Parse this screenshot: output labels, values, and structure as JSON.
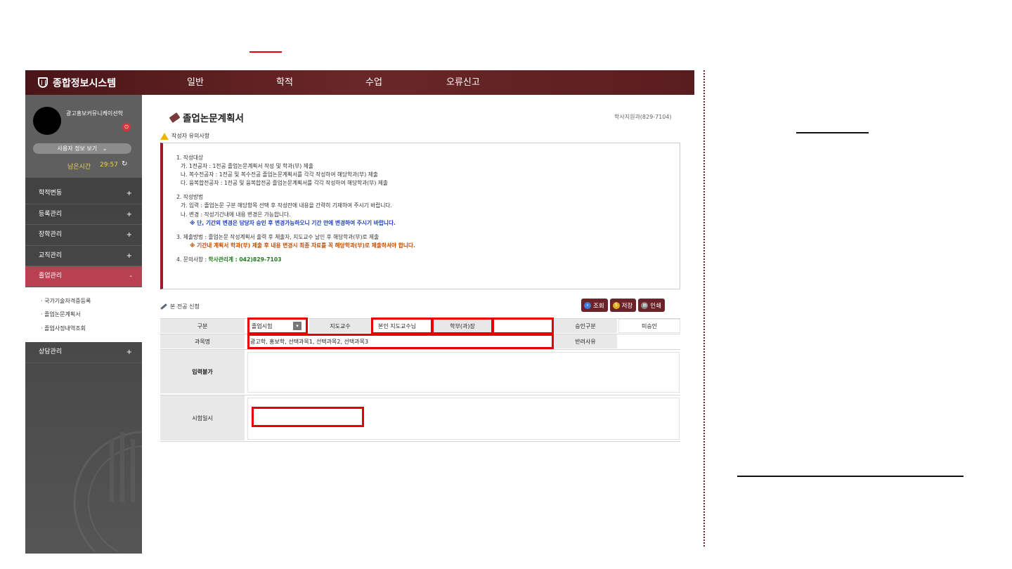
{
  "header": {
    "system_title": "종합정보시스템",
    "nav": [
      "일반",
      "학적",
      "수업",
      "오류신고"
    ]
  },
  "profile": {
    "name": "광고홍보커뮤니케이션학",
    "user_info_button": "사용자 정보 보기",
    "session_label": "남은시간",
    "session_time": "29:57"
  },
  "sidebar": {
    "menu": [
      {
        "label": "학적변동",
        "toggle": "+"
      },
      {
        "label": "등록관리",
        "toggle": "+"
      },
      {
        "label": "장학관리",
        "toggle": "+"
      },
      {
        "label": "교직관리",
        "toggle": "+"
      },
      {
        "label": "졸업관리",
        "toggle": "-"
      }
    ],
    "submenu": [
      "· 국가기술자격증등록",
      "· 졸업논문계획서",
      "· 졸업사정내역조회"
    ],
    "menu_after": [
      {
        "label": "상담관리",
        "toggle": "+"
      }
    ]
  },
  "page": {
    "title": "졸업논문계획서",
    "contact": "학사지원과(829-7104)",
    "caution_title": "작성자 유의사항"
  },
  "notice": {
    "s1_title": "1. 작성대상",
    "s1_a": "가. 1전공자 : 1전공 졸업논문계획서 작성 및 학과(부) 제출",
    "s1_b": "나. 복수전공자 : 1전공 및 복수전공 졸업논문계획서를 각각 작성하여 해당학과(부) 제출",
    "s1_c": "다. 융복합전공자 : 1전공 및 융복합전공 졸업논문계획서를 각각 작성하여 해당학과(부) 제출",
    "s2_title": "2. 작성방법",
    "s2_a": "가. 입력 : 졸업논문 구분 해당항목 선택 후 작성란에 내용을 간략히 기재하여 주시기 바랍니다.",
    "s2_b": "나. 변경 : 작성기간내에 내용 변경은 가능합니다.",
    "s2_note": "※ 단, 기간외 변경은 담당자 승인 후 변경가능하오니 기간 안에 변경하여 주시기 바랍니다.",
    "s3": "3. 제출방법 : 졸업논문 작성계획서 출력 후 제출자, 지도교수 날인 후 해당학과(부)로 제출",
    "s3_note": "※ 기간내 계획서 학과(부) 제출 후 내용 변경시 최종 자료를 꼭 해당학과(부)로 제출하셔야 합니다.",
    "s4_label": "4. 문의사항 : ",
    "s4_value": "학사관리계 : 042)829-7103"
  },
  "section": {
    "title": "본 전공 신청",
    "buttons": {
      "search": "조회",
      "save": "저장",
      "print": "인쇄"
    }
  },
  "form": {
    "label_type": "구분",
    "type_value": "졸업시험",
    "label_advisor": "지도교수",
    "advisor_value": "본인 지도교수님",
    "label_head": "학부(과)장",
    "head_value": "",
    "label_approval": "승인구분",
    "approval_value": "미승인",
    "label_subjects": "과목명",
    "subjects_value": "광고학, 홍보학, 선택과목1, 선택과목2, 선택과목3",
    "label_reject": "반려사유",
    "reject_value": "",
    "label_input_na": "입력불가",
    "label_exam_date": "시험일시",
    "exam_date_value": ""
  }
}
